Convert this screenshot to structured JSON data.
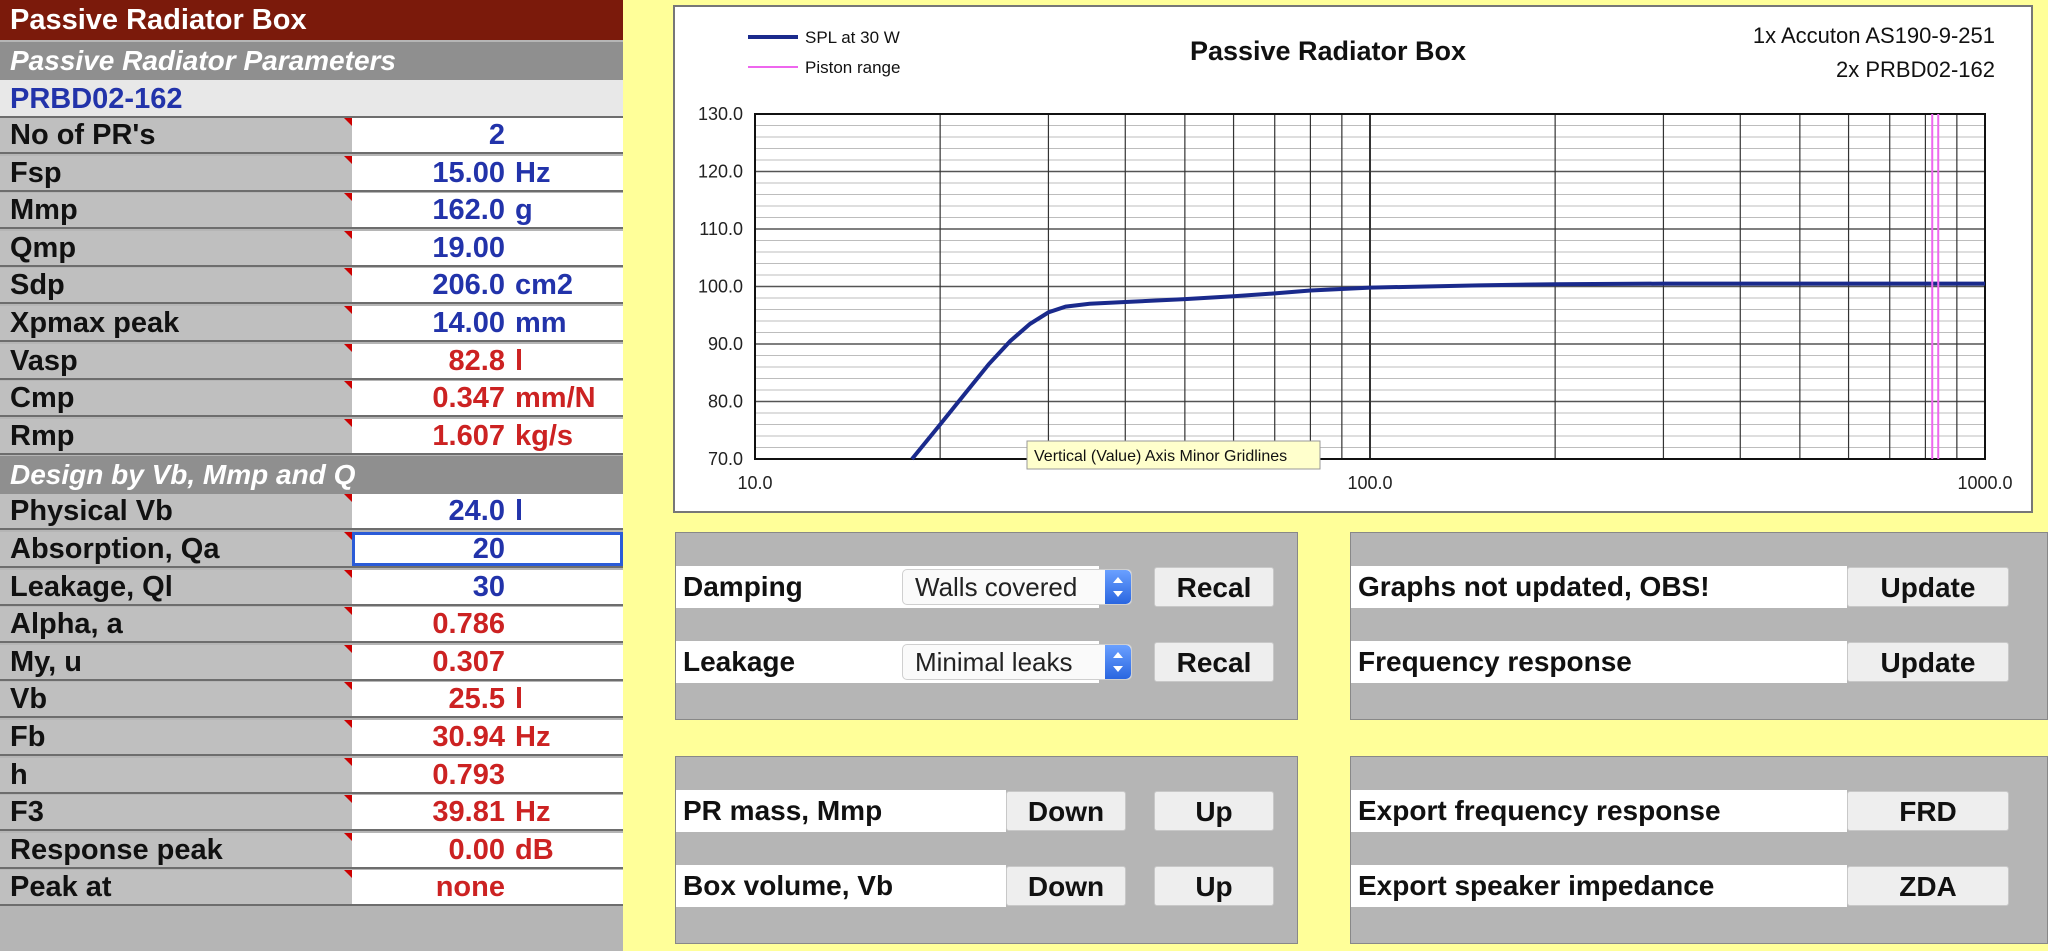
{
  "sheet": {
    "title": "Passive Radiator Box",
    "section1": "Passive Radiator Parameters",
    "pr_name": "PRBD02-162",
    "params": [
      {
        "label": "No of PR's",
        "value": "2",
        "unit": "",
        "color": "blue"
      },
      {
        "label": "Fsp",
        "value": "15.00",
        "unit": "Hz",
        "color": "blue"
      },
      {
        "label": "Mmp",
        "value": "162.0",
        "unit": "g",
        "color": "blue"
      },
      {
        "label": "Qmp",
        "value": "19.00",
        "unit": "",
        "color": "blue"
      },
      {
        "label": "Sdp",
        "value": "206.0",
        "unit": "cm2",
        "color": "blue"
      },
      {
        "label": "Xpmax peak",
        "value": "14.00",
        "unit": "mm",
        "color": "blue"
      },
      {
        "label": "Vasp",
        "value": "82.8",
        "unit": "l",
        "color": "red"
      },
      {
        "label": "Cmp",
        "value": "0.347",
        "unit": "mm/N",
        "color": "red"
      },
      {
        "label": "Rmp",
        "value": "1.607",
        "unit": "kg/s",
        "color": "red"
      }
    ],
    "section2": "Design by Vb, Mmp and Q",
    "design": [
      {
        "label": "Physical Vb",
        "value": "24.0",
        "unit": "l",
        "color": "blue"
      },
      {
        "label": "Absorption, Qa",
        "value": "20",
        "unit": "",
        "color": "blue"
      },
      {
        "label": "Leakage, Ql",
        "value": "30",
        "unit": "",
        "color": "blue"
      },
      {
        "label": "Alpha, a",
        "value": "0.786",
        "unit": "",
        "color": "red"
      },
      {
        "label": "My, u",
        "value": "0.307",
        "unit": "",
        "color": "red"
      },
      {
        "label": "Vb",
        "value": "25.5",
        "unit": "l",
        "color": "red"
      },
      {
        "label": "Fb",
        "value": "30.94",
        "unit": "Hz",
        "color": "red"
      },
      {
        "label": "h",
        "value": "0.793",
        "unit": "",
        "color": "red"
      },
      {
        "label": "F3",
        "value": "39.81",
        "unit": "Hz",
        "color": "red"
      },
      {
        "label": "Response peak",
        "value": "0.00",
        "unit": "dB",
        "color": "red"
      },
      {
        "label": "Peak at",
        "value": "none",
        "unit": "",
        "color": "red"
      }
    ]
  },
  "chart_data": {
    "type": "line",
    "title": "Passive Radiator Box",
    "subtitle_lines": [
      "1x Accuton AS190-9-251",
      "2x PRBD02-162"
    ],
    "x_scale": "log",
    "xlim": [
      10,
      1000
    ],
    "ylim": [
      70,
      130
    ],
    "x_tick_labels": [
      "10.0",
      "100.0",
      "1000.0"
    ],
    "y_tick_labels": [
      "70.0",
      "80.0",
      "90.0",
      "100.0",
      "110.0",
      "120.0",
      "130.0"
    ],
    "grid": true,
    "legend": [
      "SPL at 30 W",
      "Piston range"
    ],
    "legend_position": "top-left",
    "series": [
      {
        "name": "SPL at 30 W",
        "color": "#1a2a8c",
        "x": [
          18.0,
          20,
          22,
          24,
          26,
          28,
          30,
          32,
          35,
          40,
          50,
          60,
          70,
          80,
          100,
          150,
          200,
          300,
          500,
          700,
          1000
        ],
        "y": [
          70.0,
          76.0,
          81.5,
          86.5,
          90.5,
          93.5,
          95.5,
          96.5,
          97.0,
          97.3,
          97.8,
          98.3,
          98.8,
          99.3,
          99.8,
          100.2,
          100.4,
          100.5,
          100.5,
          100.5,
          100.5
        ]
      },
      {
        "name": "Piston range",
        "color": "#ee66ee",
        "x": [
          830,
          830
        ],
        "y": [
          70,
          130
        ]
      }
    ],
    "tooltip": "Vertical (Value) Axis Minor Gridlines"
  },
  "controls": {
    "damping": {
      "label": "Damping",
      "select": "Walls covered",
      "button": "Recal"
    },
    "leakage": {
      "label": "Leakage",
      "select": "Minimal leaks",
      "button": "Recal"
    },
    "graphs_status": {
      "label": "Graphs not updated, OBS!",
      "button": "Update"
    },
    "freq_resp": {
      "label": "Frequency response",
      "button": "Update"
    },
    "pr_mass": {
      "label": "PR mass, Mmp",
      "down": "Down",
      "up": "Up"
    },
    "box_volume": {
      "label": "Box volume, Vb",
      "down": "Down",
      "up": "Up"
    },
    "export_frd": {
      "label": "Export frequency response",
      "button": "FRD"
    },
    "export_zda": {
      "label": "Export speaker impedance",
      "button": "ZDA"
    }
  }
}
